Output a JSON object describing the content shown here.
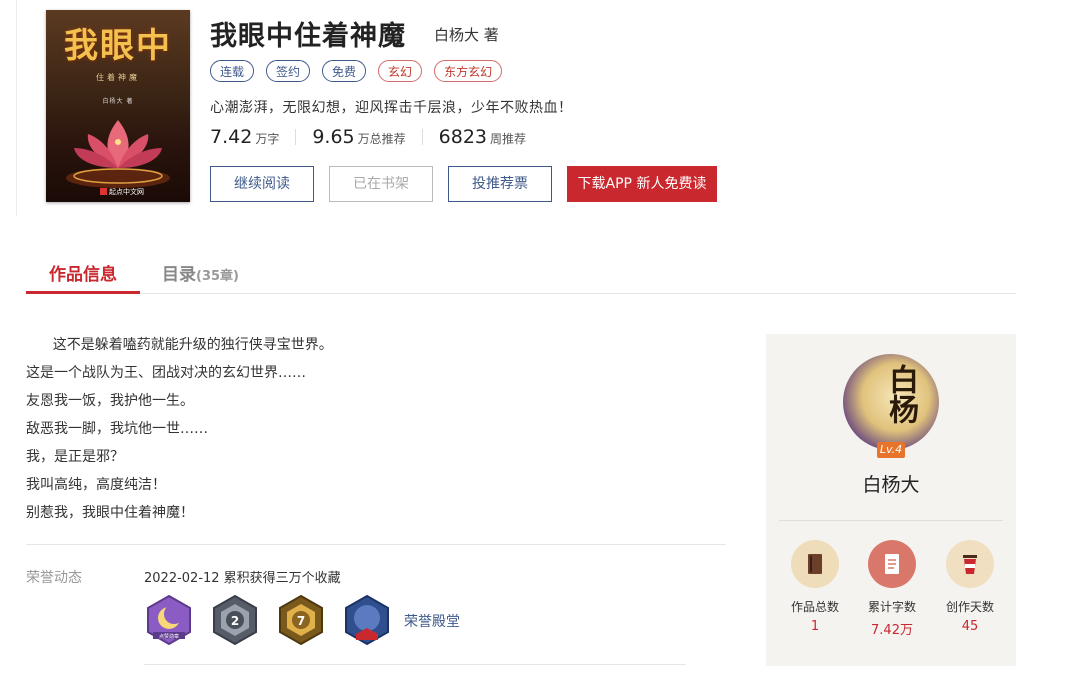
{
  "book": {
    "title": "我眼中住着神魔",
    "author": "白杨大 著",
    "tags": [
      {
        "label": "连载",
        "style": "blue"
      },
      {
        "label": "签约",
        "style": "blue"
      },
      {
        "label": "免费",
        "style": "blue"
      },
      {
        "label": "玄幻",
        "style": "red"
      },
      {
        "label": "东方玄幻",
        "style": "red"
      }
    ],
    "intro": "心潮澎湃，无限幻想，迎风挥击千层浪，少年不败热血！",
    "stats": [
      {
        "num": "7.42",
        "unit": "万字"
      },
      {
        "num": "9.65",
        "unit": "万总推荐"
      },
      {
        "num": "6823",
        "unit": "周推荐"
      }
    ],
    "cover": {
      "title": "我眼中",
      "subtitle": "住着神魔",
      "author": "白杨大 著",
      "publisher": "起点中文网"
    }
  },
  "buttons": {
    "continue_read": "继续阅读",
    "on_shelf": "已在书架",
    "vote": "投推荐票",
    "download_app": "下载APP 新人免费读"
  },
  "tabs": {
    "info": "作品信息",
    "toc": "目录",
    "toc_count": "(35章)"
  },
  "description": [
    "      这不是躲着嗑药就能升级的独行侠寻宝世界。",
    "这是一个战队为王、团战对决的玄幻世界……",
    "友恩我一饭，我护他一生。",
    "敌恶我一脚，我坑他一世……",
    "我，是正是邪？",
    "我叫高纯，高度纯洁！",
    "别惹我，我眼中住着神魔！"
  ],
  "honor": {
    "label": "荣誉动态",
    "entry": "2022-02-12 累积获得三万个收藏",
    "hall_link": "荣誉殿堂",
    "badges": [
      {
        "name": "moon-badge",
        "color": "#7d4fb0",
        "text": "点赞勋章"
      },
      {
        "name": "rank-2-badge",
        "color": "#6b7280",
        "text": "2"
      },
      {
        "name": "rank-7-badge",
        "color": "#b8892c",
        "text": "7"
      },
      {
        "name": "mascot-badge",
        "color": "#2f4f8f",
        "text": "白盟金羽"
      }
    ]
  },
  "author_panel": {
    "avatar_text": "白杨",
    "level": "Lv.4",
    "name": "白杨大",
    "stats": [
      {
        "label": "作品总数",
        "value": "1"
      },
      {
        "label": "累计字数",
        "value": "7.42万"
      },
      {
        "label": "创作天数",
        "value": "45"
      }
    ]
  },
  "colors": {
    "accent_red": "#c9282e",
    "accent_blue": "#3f5a8a"
  }
}
